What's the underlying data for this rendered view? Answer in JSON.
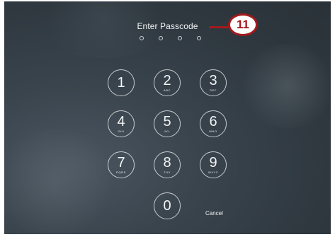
{
  "lock_screen": {
    "title": "Enter Passcode",
    "passcode_dot_count": 4,
    "keys": [
      {
        "digit": "1",
        "letters": ""
      },
      {
        "digit": "2",
        "letters": "ABC"
      },
      {
        "digit": "3",
        "letters": "DEF"
      },
      {
        "digit": "4",
        "letters": "GHI"
      },
      {
        "digit": "5",
        "letters": "JKL"
      },
      {
        "digit": "6",
        "letters": "MNO"
      },
      {
        "digit": "7",
        "letters": "PQRS"
      },
      {
        "digit": "8",
        "letters": "TUV"
      },
      {
        "digit": "9",
        "letters": "WXYZ"
      },
      {
        "digit": "0",
        "letters": ""
      }
    ],
    "cancel_label": "Cancel"
  },
  "callout": {
    "number": "11",
    "color": "#a3191d"
  }
}
